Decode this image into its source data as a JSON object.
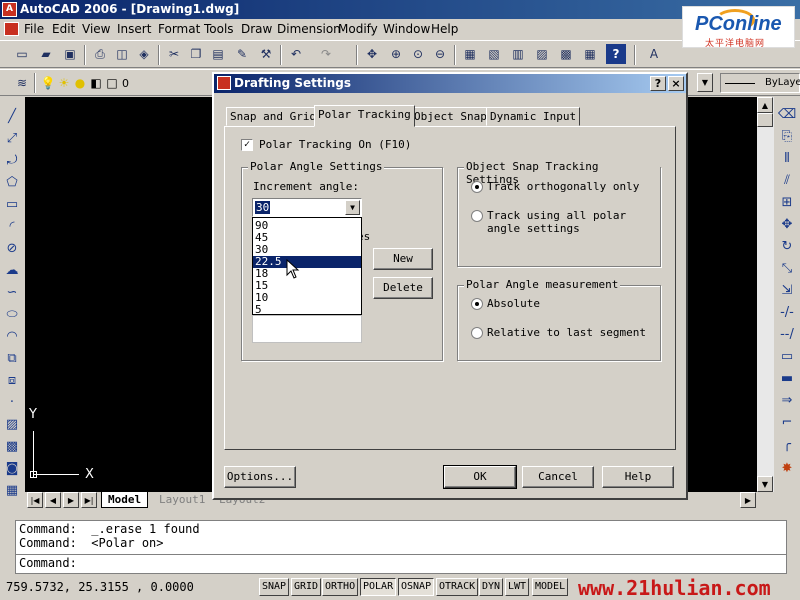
{
  "app": {
    "title": "AutoCAD 2006 - [Drawing1.dwg]",
    "icon": "autocad-logo-icon"
  },
  "menu": [
    "File",
    "Edit",
    "View",
    "Insert",
    "Format",
    "Tools",
    "Draw",
    "Dimension",
    "Modify",
    "Window",
    "Help"
  ],
  "logo": {
    "brand": "PConline",
    "sub": "太平洋电脑网"
  },
  "layer_bar": {
    "layer_name": "0",
    "linetype": "ByLaye"
  },
  "ucs": {
    "y": "Y",
    "x": "X"
  },
  "layout_tabs": {
    "model": "Model",
    "layout1": "Layout1",
    "layout2": "Layout2"
  },
  "command_lines": [
    "Command:  _.erase 1 found",
    "Command:  <Polar on>",
    "Command:"
  ],
  "status": {
    "coords": "759.5732,  25.3155 , 0.0000",
    "buttons": [
      "SNAP",
      "GRID",
      "ORTHO",
      "POLAR",
      "OSNAP",
      "OTRACK",
      "DYN",
      "LWT",
      "MODEL"
    ],
    "active": [
      "POLAR",
      "OSNAP"
    ],
    "watermark": "www.21hulian.com"
  },
  "dialog": {
    "title": "Drafting Settings",
    "help_btn": "?",
    "close_btn": "×",
    "tabs": [
      "Snap and Grid",
      "Polar Tracking",
      "Object Snap",
      "Dynamic Input"
    ],
    "active_tab": "Polar Tracking",
    "polar_on_label": "Polar Tracking On (F10)",
    "polar_on_checked": true,
    "polar_angle_group": "Polar Angle Settings",
    "increment_label": "Increment angle:",
    "increment_value": "30",
    "increment_options": [
      "90",
      "45",
      "30",
      "22.5",
      "18",
      "15",
      "10",
      "5"
    ],
    "highlighted_option": "22.5",
    "additional_angles_partial": "es",
    "new_btn": "New",
    "delete_btn": "Delete",
    "osnap_group": "Object Snap Tracking Settings",
    "track_ortho": "Track orthogonally only",
    "track_all_line1": "Track using all polar",
    "track_all_line2": "angle settings",
    "measurement_group": "Polar Angle measurement",
    "absolute": "Absolute",
    "relative": "Relative to last segment",
    "options_btn": "Options...",
    "ok_btn": "OK",
    "cancel_btn": "Cancel",
    "help_button": "Help"
  },
  "colors": {
    "titlebar": "#0a246a",
    "canvas": "#000000",
    "selection": "#0a246a",
    "face": "#d4d0c8"
  }
}
